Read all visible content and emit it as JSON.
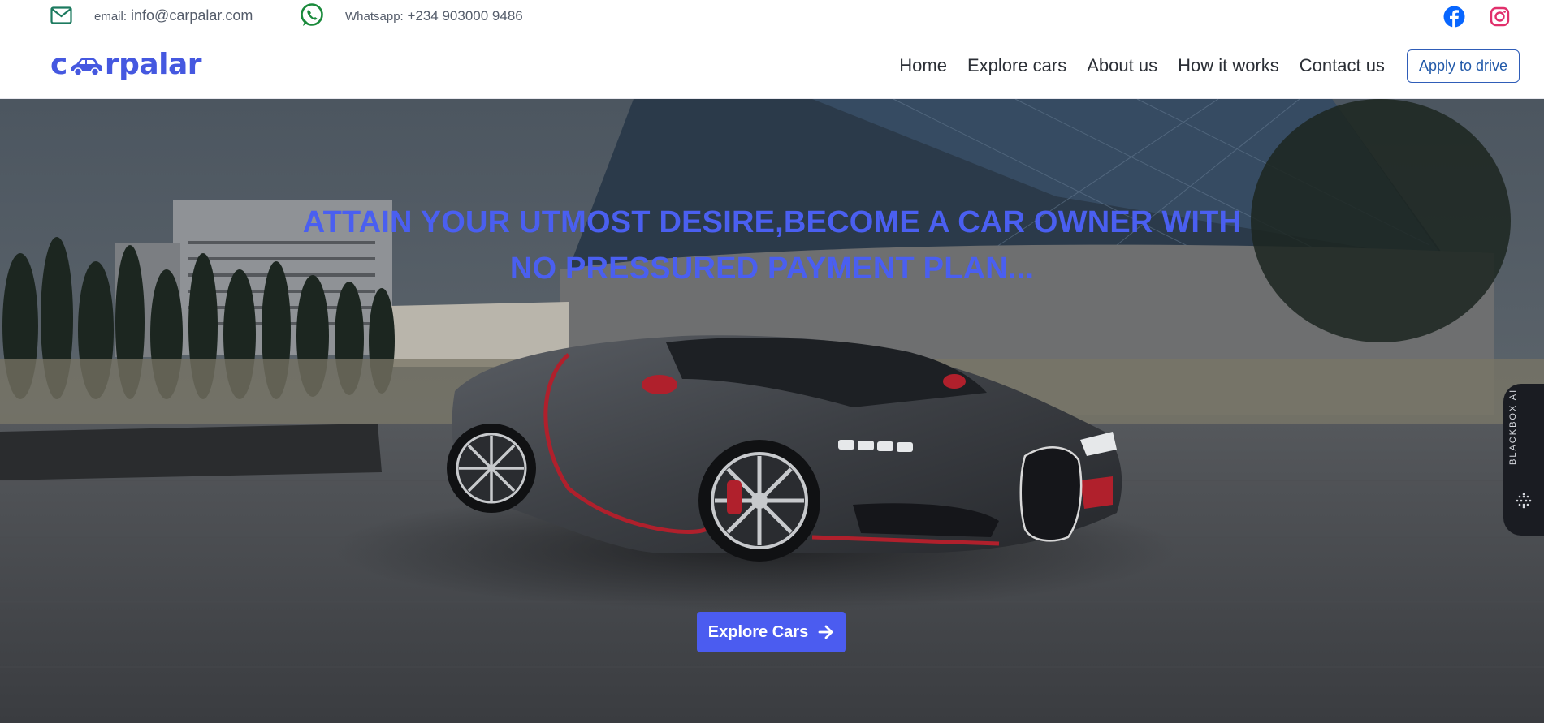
{
  "topbar": {
    "email_prefix": "email:",
    "email": "info@carpalar.com",
    "whatsapp_prefix": "Whatsapp:",
    "whatsapp": "+234 903000 9486"
  },
  "brand": {
    "logo_left": "c",
    "logo_right": "rpalar",
    "color": "#4558e0"
  },
  "nav": {
    "links": [
      "Home",
      "Explore cars",
      "About us",
      "How it works",
      "Contact us"
    ],
    "apply_label": "Apply to drive"
  },
  "hero": {
    "headline_line1": "ATTAIN YOUR UTMOST DESIRE,BECOME A CAR OWNER WITH",
    "headline_line2": "NO PRESSURED PAYMENT PLAN...",
    "cta_label": "Explore Cars",
    "headline_color": "#4a5ff0",
    "cta_color": "#4b5cf0"
  },
  "side_tab": {
    "label": "BLACKBOX AI"
  },
  "icons": {
    "email": "envelope-icon",
    "whatsapp": "whatsapp-icon",
    "facebook": "facebook-icon",
    "instagram": "instagram-icon",
    "cta_arrow": "arrow-right-icon"
  }
}
